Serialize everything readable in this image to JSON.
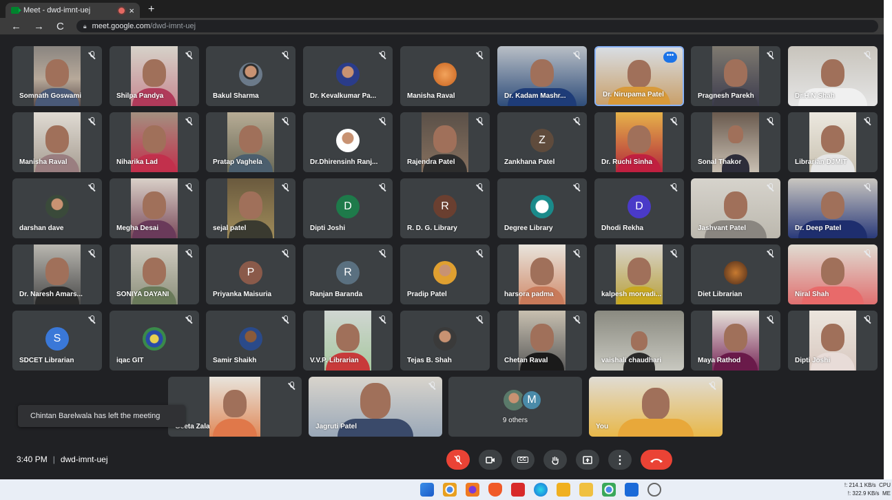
{
  "browser": {
    "tab_title": "Meet - dwd-imnt-uej",
    "tab_close": "×",
    "new_tab": "+",
    "url_host": "meet.google.com",
    "url_path": "/dwd-imnt-uej"
  },
  "participants_row1": [
    "Somnath Goswami",
    "Shilpa Pandya",
    "Bakul Sharma",
    "Dr. Kevalkumar Pa...",
    "Manisha Raval",
    "Dr. Kadam Mashr...",
    "Dr. Nirupama Patel",
    "Pragnesh Parekh",
    "Dr.H.N Shah"
  ],
  "participants_row2": [
    "Manisha Raval",
    "Niharika Lad",
    "Pratap Vaghela",
    "Dr.Dhirensinh Ranj...",
    "Rajendra Patel",
    "Zankhana Patel",
    "Dr. Ruchi Sinha",
    "Sonal Thakor",
    "Librarian DJMIT"
  ],
  "participants_row3": [
    "darshan dave",
    "Megha Desai",
    "sejal patel",
    "Dipti Joshi",
    "R. D. G. Library",
    "Degree Library",
    "Dhodi Rekha",
    "Jashvant Patel",
    "Dr. Deep Patel"
  ],
  "participants_row4": [
    "Dr. Naresh Amars...",
    "SONIYA DAYANI",
    "Priyanka Maisuria",
    "Ranjan Baranda",
    "Pradip Patel",
    "harsora padma",
    "kalpesh morvadi...",
    "Diet Librarian",
    "Niral Shah"
  ],
  "participants_row5": [
    "SDCET Librarian",
    "iqac GIT",
    "Samir Shaikh",
    "V.V.P. Librarian",
    "Tejas B. Shah",
    "Chetan Raval",
    "vaishali chaudhari",
    "Maya Rathod",
    "Dipti Joshi"
  ],
  "participants_row6": [
    "Geeta Zala",
    "Jagruti Patel",
    "9 others",
    "You"
  ],
  "initials": {
    "zankhana": "Z",
    "dipti": "D",
    "rdg": "R",
    "dhodi": "D",
    "priyanka": "P",
    "ranjan": "R",
    "sdcet": "S",
    "others": "M"
  },
  "more_options": "•••",
  "toast": "Chintan Barelwala has left the meeting",
  "meeting": {
    "time": "3:40 PM",
    "separator": "|",
    "code": "dwd-imnt-uej"
  },
  "controls": {
    "captions": "CC",
    "more": "⋮"
  },
  "tray": {
    "line1": "!: 214.1 KB/s",
    "line2": "!: 322.9 KB/s",
    "cpu": "CPU",
    "mem": "ME"
  },
  "colors": {
    "meet_bg": "#202124",
    "tile_bg": "#3c4043",
    "end_call": "#ea4335",
    "mic_off": "#ea4335"
  }
}
